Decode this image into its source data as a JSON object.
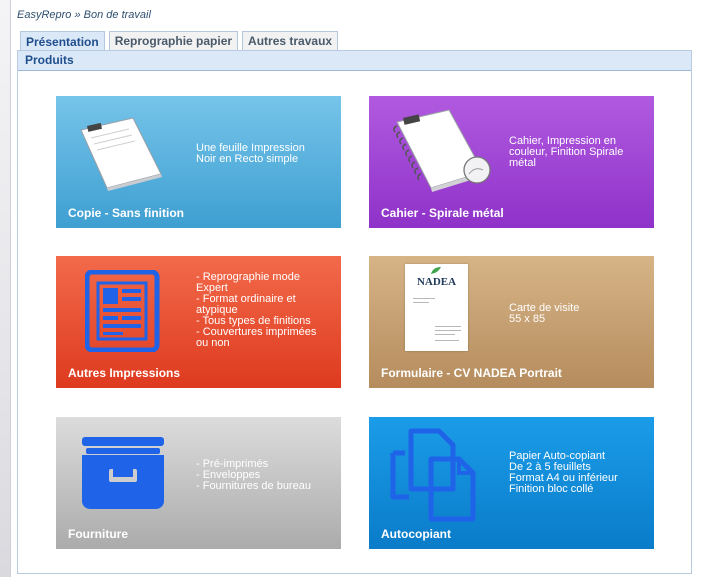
{
  "breadcrumb": {
    "app": "EasyRepro",
    "separator": "»",
    "page": "Bon de travail"
  },
  "tabs": [
    {
      "label": "Présentation",
      "active": true
    },
    {
      "label": "Reprographie papier",
      "active": false
    },
    {
      "label": "Autres travaux",
      "active": false
    }
  ],
  "section": {
    "title": "Produits"
  },
  "tiles": [
    {
      "title": "Copie - Sans finition",
      "description": "Une feuille Impression\nNoir en Recto simple",
      "color": "#4aa8d8",
      "icon": "paper-sheet-icon"
    },
    {
      "title": "Cahier - Spirale métal",
      "description": "Cahier, Impression en\ncouleur, Finition Spirale\nmétal",
      "color": "#9b3fd4",
      "icon": "spiral-notebook-icon"
    },
    {
      "title": "Autres Impressions",
      "description": "- Reprographie mode\nExpert\n- Format ordinaire et\natypique\n- Tous types de finitions\n- Couvertures imprimées\nou non",
      "color": "#e8432a",
      "icon": "document-layout-icon"
    },
    {
      "title": "Formulaire - CV NADEA Portrait",
      "description": "Carte de visite\n55 x 85",
      "color": "#c49a6c",
      "icon": "business-card-icon",
      "card_brand": "NADEA"
    },
    {
      "title": "Fourniture",
      "description": "- Pré-imprimés\n- Enveloppes\n- Fournitures de bureau",
      "color": "#b8b8b8",
      "icon": "filing-drawer-icon"
    },
    {
      "title": "Autocopiant",
      "description": "Papier Auto-copiant\nDe 2 à 5 feuillets\nFormat A4 ou inférieur\nFinition bloc collé",
      "color": "#0d87d8",
      "icon": "copies-icon"
    }
  ]
}
